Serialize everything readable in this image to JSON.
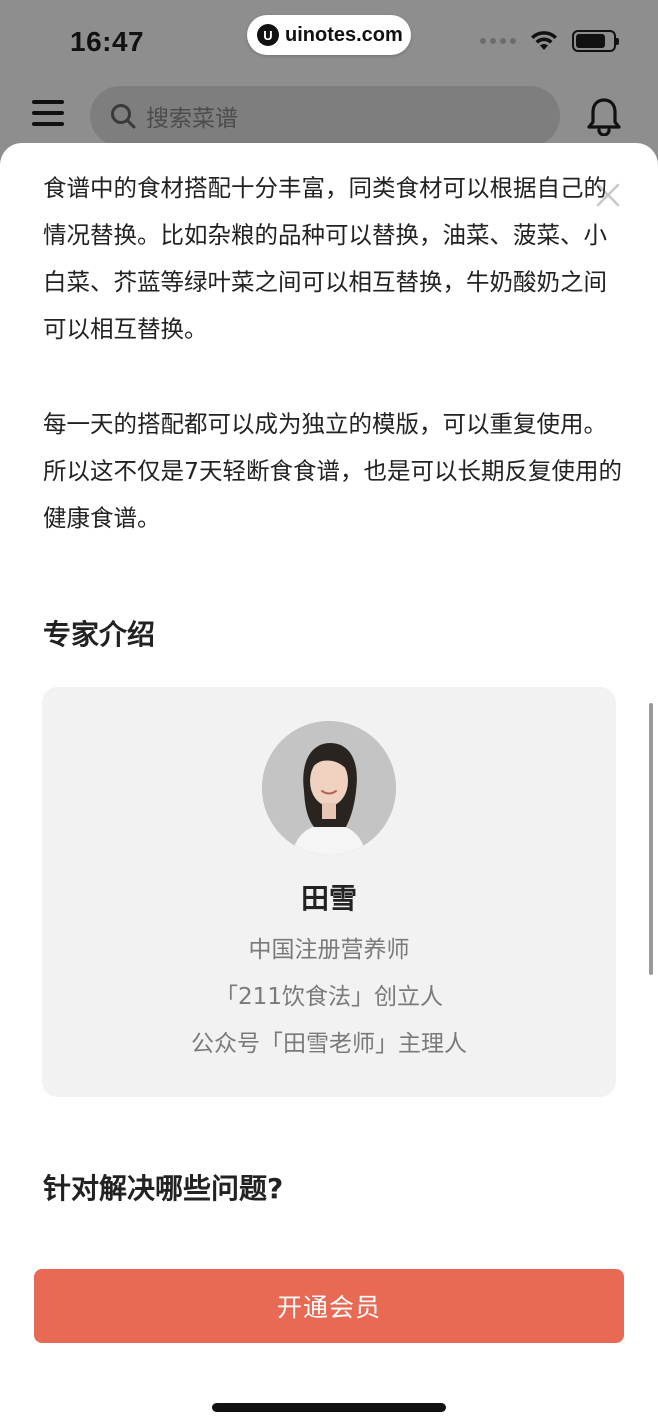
{
  "status_bar": {
    "time": "16:47",
    "watermark_logo": "U",
    "watermark_text": "uinotes.com",
    "icons": [
      "signal-dots-icon",
      "wifi-icon",
      "battery-icon"
    ]
  },
  "top_bar": {
    "menu_icon": "hamburger-menu-icon",
    "search_placeholder": "搜索菜谱",
    "bell_icon": "notification-bell-icon"
  },
  "sheet": {
    "close_icon": "close-icon",
    "paragraph_1": "食谱中的食材搭配十分丰富，同类食材可以根据自己的情况替换。比如杂粮的品种可以替换，油菜、菠菜、小白菜、芥蓝等绿叶菜之间可以相互替换，牛奶酸奶之间可以相互替换。",
    "paragraph_2": "每一天的搭配都可以成为独立的模版，可以重复使用。所以这不仅是7天轻断食食谱，也是可以长期反复使用的健康食谱。",
    "expert_section_title": "专家介绍",
    "expert": {
      "name": "田雪",
      "line_1": "中国注册营养师",
      "line_2": "「211饮食法」创立人",
      "line_3": "公众号「田雪老师」主理人"
    },
    "problems_section_title": "针对解决哪些问题?",
    "cta_label": "开通会员"
  },
  "colors": {
    "accent": "#e86a55",
    "overlay": "#8e8e8e",
    "card_bg": "#f2f2f2",
    "muted_text": "#7a7a7a"
  }
}
